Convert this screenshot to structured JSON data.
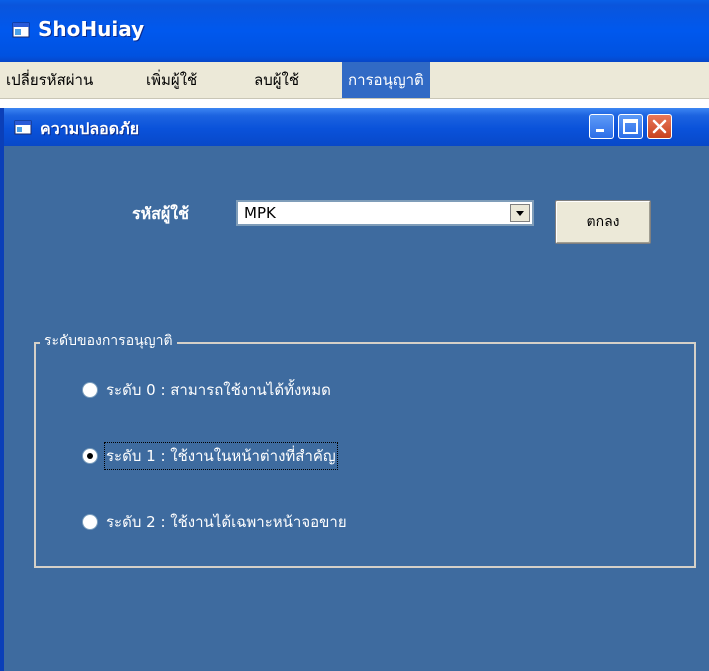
{
  "app": {
    "title": "ShoHuiay"
  },
  "menu": {
    "items": [
      {
        "label": "เปลี่ยรหัสผ่าน"
      },
      {
        "label": "เพิ่มผู้ใช้"
      },
      {
        "label": "ลบผู้ใช้"
      },
      {
        "label": "การอนุญาติ"
      }
    ],
    "active_index": 3
  },
  "window": {
    "title": "ความปลอดภัย"
  },
  "form": {
    "user_label": "รหัสผู้ใช้",
    "user_value": "MPK",
    "ok_label": "ตกลง"
  },
  "permission": {
    "group_label": "ระดับของการอนุญาติ",
    "options": [
      {
        "label": "ระดับ 0 : สามารถใช้งานได้ทั้งหมด",
        "checked": false
      },
      {
        "label": "ระดับ 1 : ใช้งานในหน้าต่างที่สำคัญ",
        "checked": true
      },
      {
        "label": "ระดับ 2 : ใช้งานได้เฉพาะหน้าจอขาย",
        "checked": false
      }
    ]
  },
  "colors": {
    "titlebar": "#0058ee",
    "client_bg": "#3e6b9f",
    "menu_highlight": "#316ac5",
    "close_button": "#c8421e"
  },
  "icons": [
    "app-window-icon",
    "minimize-icon",
    "maximize-icon",
    "close-icon",
    "dropdown-arrow-icon"
  ]
}
